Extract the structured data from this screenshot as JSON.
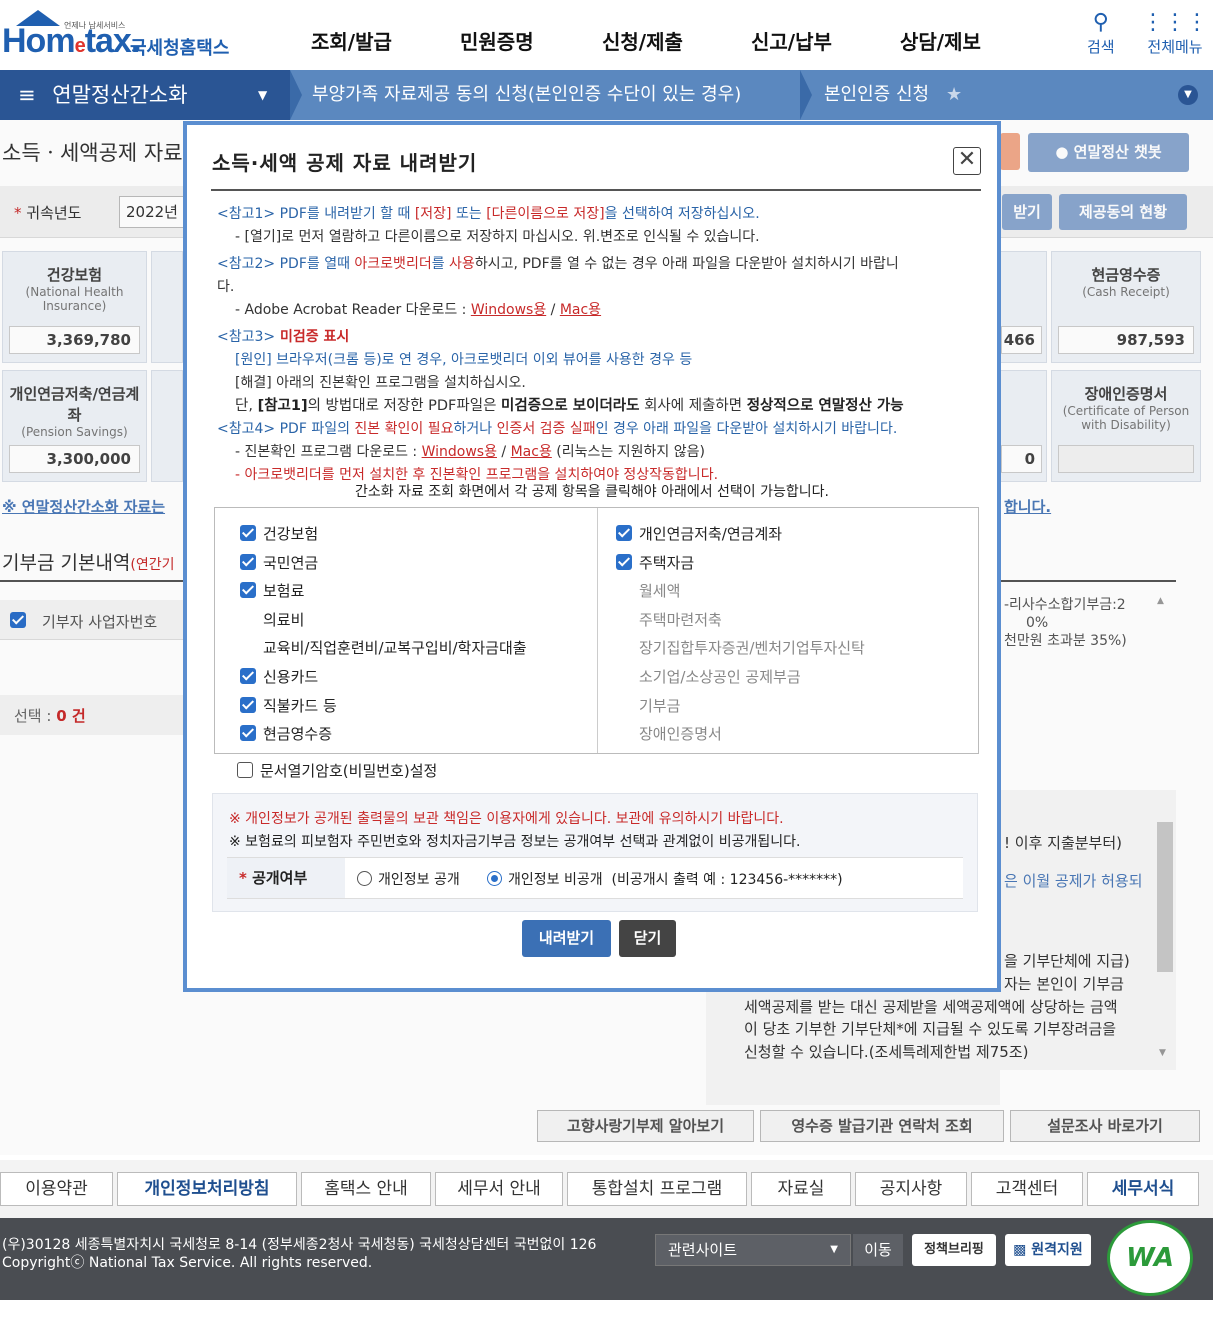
{
  "header": {
    "logo_small": "언제나 납세서비스",
    "logo_brand_a": "Hom",
    "logo_brand_e": "e",
    "logo_brand_b": "tax.",
    "logo_kor": "국세청홈택스",
    "menu": [
      "조회/발급",
      "민원증명",
      "신청/제출",
      "신고/납부",
      "상담/제보"
    ],
    "search_label": "검색",
    "allmenu_label": "전체메뉴"
  },
  "nav": {
    "current": "연말정산간소화",
    "crumb1": "부양가족 자료제공 동의 신청(본인인증 수단이 있는 경우)",
    "crumb2": "본인인증 신청"
  },
  "background": {
    "page_title": "소득ㆍ세액공제 자료",
    "chatbot": "연말정산 챗봇",
    "year_label": "귀속년도",
    "year_value": "2022년",
    "btn_download": "받기",
    "btn_consent": "제공동의 현황",
    "cards": [
      {
        "label": "건강보험",
        "en": "(National Health Insurance)",
        "value": "3,369,780"
      },
      {
        "label": "현금영수증",
        "en": "(Cash Receipt)",
        "value": "987,593"
      },
      {
        "label": "개인연금저축/연금계좌",
        "en": "(Pension Savings)",
        "value": "3,300,000"
      },
      {
        "label": "장애인증명서",
        "en": "(Certificate of Person with Disability)",
        "value": ""
      }
    ],
    "partial_value_a": "466",
    "partial_value_b": "0",
    "notice_link": "※ 연말정산간소화 자료는",
    "notice_link_tail": "합니다.",
    "donation_title": "기부금 기본내역",
    "donation_sub": "(연간기",
    "table_head": "기부자 사업자번호",
    "selected_label": "선택 :",
    "selected_count": "0 건",
    "right_text1": "-리사수소합기부금:2",
    "right_text2": "0%",
    "right_text3": "천만원 초과분 35%)",
    "right_text4": "! 이후 지출분부터)",
    "right_text5": "은 이월 공제가 허용되",
    "right_text6": "을 기부단체에 지급)",
    "right_text7": "자는 본인이 기부금",
    "right_text8": "세액공제를 받는 대신 공제받을 세액공제액에 상당하는 금액",
    "right_text9": "이 당초 기부한 기부단체*에 지급될 수 있도록 기부장려금을",
    "right_text10": "신청할 수 있습니다.(조세특례제한법 제75조)",
    "bottom_btns": [
      "고향사랑기부제 알아보기",
      "영수증 발급기관 연락처 조회",
      "설문조사 바로가기"
    ]
  },
  "modal": {
    "title": "소득·세액 공제 자료 내려받기",
    "notes": {
      "r1_tag": "<참고1>",
      "r1_a": " PDF를 내려받기 할 때 ",
      "r1_save": "[저장]",
      "r1_b": " 또는 ",
      "r1_saveas": "[다른이름으로 저장]",
      "r1_c": "을 선택하여 저장하십시오.",
      "r1_sub": "- [열기]로 먼저 열람하고 다른이름으로 저장하지 마십시오. 위.변조로 인식될 수 있습니다.",
      "r2_tag": "<참고2>",
      "r2_a": " PDF를 열때 ",
      "r2_acro": "아크로뱃리더",
      "r2_b": "를 ",
      "r2_use": "사용",
      "r2_c": "하시고, PDF를 열 수 없는 경우 아래 파일을 다운받아 설치하시기 바랍니",
      "r2_d": "다.",
      "r2_sub": "- Adobe Acrobat Reader 다운로드 : ",
      "r2_win": "Windows용",
      "r2_slash": " / ",
      "r2_mac": "Mac용",
      "r3_tag": "<참고3>",
      "r3_title": " 미검증 표시",
      "r3_cause": "[원인] 브라우저(크롬 등)로 연 경우, 아크로뱃리더 이외 뷰어를 사용한 경우 등",
      "r3_solve": "[해결] 아래의 진본확인 프로그램을 설치하십시오.",
      "r3_c_a": "단, ",
      "r3_c_b": "[참고1]",
      "r3_c_c": "의 방법대로 저장한 PDF파일은 ",
      "r3_c_d": "미검증으로 보이더라도",
      "r3_c_e": " 회사에 제출하면 ",
      "r3_c_f": "정상적으로 연말정산 가능",
      "r4_tag": "<참고4>",
      "r4_a": " PDF 파일의 ",
      "r4_b": "진본 확인이 필요",
      "r4_c": "하거나 ",
      "r4_d": "인증서 검증 실패",
      "r4_e": "인 경우 아래 파일을 다운받아 설치하시기 바랍니다.",
      "r4_sub": "- 진본확인 프로그램 다운로드 : ",
      "r4_win": "Windows용",
      "r4_slash": " / ",
      "r4_mac": "Mac용",
      "r4_tail": " (리눅스는 지원하지 않음)",
      "r4_cut": "- 아크로뱃리더를 먼저 설치한 후 진본확인 프로그램을 설치하여야 정상작동합니다."
    },
    "guide": "간소화 자료 조회 화면에서 각 공제 항목을 클릭해야 아래에서 선택이 가능합니다.",
    "left_items": [
      {
        "label": "건강보험",
        "checked": true
      },
      {
        "label": "국민연금",
        "checked": true
      },
      {
        "label": "보험료",
        "checked": true
      },
      {
        "label": "의료비",
        "checked": false
      },
      {
        "label": "교육비/직업훈련비/교복구입비/학자금대출",
        "checked": false
      },
      {
        "label": "신용카드",
        "checked": true
      },
      {
        "label": "직불카드 등",
        "checked": true
      },
      {
        "label": "현금영수증",
        "checked": true
      }
    ],
    "right_items": [
      {
        "label": "개인연금저축/연금계좌",
        "checked": true
      },
      {
        "label": "주택자금",
        "checked": true
      },
      {
        "label": "월세액",
        "checked": false
      },
      {
        "label": "주택마련저축",
        "checked": false
      },
      {
        "label": "장기집합투자증권/벤처기업투자신탁",
        "checked": false
      },
      {
        "label": "소기업/소상공인 공제부금",
        "checked": false
      },
      {
        "label": "기부금",
        "checked": false
      },
      {
        "label": "장애인증명서",
        "checked": false
      }
    ],
    "password_label": "문서열기암호(비밀번호)설정",
    "warn1": "※ 개인정보가 공개된 출력물의 보관 책임은 이용자에게 있습니다. 보관에 유의하시기 바랍니다.",
    "warn2": "※ 보험료의 피보험자 주민번호와 정치자금기부금 정보는 공개여부 선택과 관계없이 비공개됩니다.",
    "public_label": "공개여부",
    "opt_public": "개인정보 공개",
    "opt_private": "개인정보 비공개",
    "opt_example": "(비공개시 출력 예 : 123456-*******)",
    "btn_download": "내려받기",
    "btn_close": "닫기"
  },
  "footer": {
    "menu": [
      "이용약관",
      "개인정보처리방침",
      "홈택스 안내",
      "세무서 안내",
      "통합설치 프로그램",
      "자료실",
      "공지사항",
      "고객센터",
      "세무서식"
    ],
    "address": "(우)30128 세종특별자치시 국세청로 8-14 (정부세종2청사 국세청동) 국세청상담센터 국번없이 126",
    "copyright": "Copyrightⓒ National Tax Service. All rights reserved.",
    "site_select": "관련사이트",
    "go": "이동",
    "policy_btn": "정책브리핑",
    "remote_btn": "원격지원",
    "wa_mark": "WA"
  }
}
